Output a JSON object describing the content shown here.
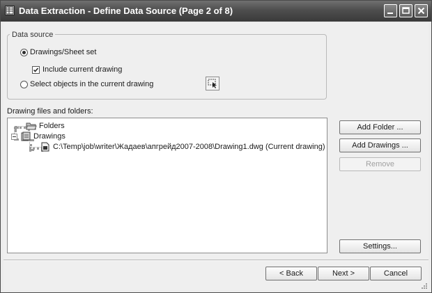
{
  "window": {
    "title": "Data Extraction - Define Data Source (Page 2 of 8)",
    "icon": "data-extraction-app-icon",
    "controls": [
      "minimize-icon",
      "maximize-icon",
      "close-icon"
    ]
  },
  "data_source": {
    "legend": "Data source",
    "drawings_option": {
      "label": "Drawings/Sheet set",
      "selected": true
    },
    "include_current": {
      "label": "Include current drawing",
      "checked": true
    },
    "select_objects_option": {
      "label": "Select objects in the current drawing",
      "selected": false
    },
    "pick_button_icon": "select-objects-icon"
  },
  "files": {
    "label": "Drawing files and folders:",
    "tree": {
      "folders": "Folders",
      "drawings": "Drawings",
      "drawing_item": "C:\\Temp\\job\\writer\\Жадаев\\апгрейд2007-2008\\Drawing1.dwg (Current drawing)"
    }
  },
  "side_buttons": {
    "add_folder": "Add Folder ...",
    "add_drawings": "Add Drawings ...",
    "remove": "Remove",
    "settings": "Settings..."
  },
  "footer": {
    "back": "< Back",
    "next": "Next >",
    "cancel": "Cancel"
  }
}
